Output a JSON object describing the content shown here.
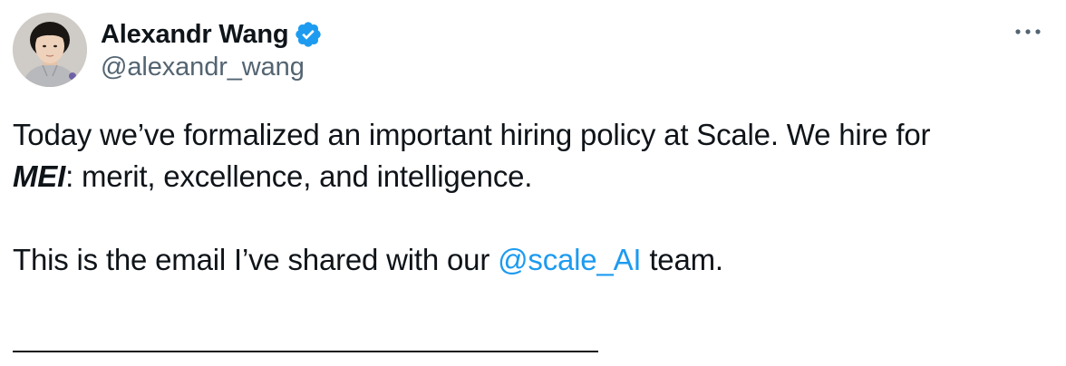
{
  "author": {
    "display_name": "Alexandr Wang",
    "handle": "@alexandr_wang",
    "verified": true,
    "verified_icon": "verified-badge-icon",
    "avatar_icon": "avatar-photo"
  },
  "menu": {
    "icon": "more-horizontal-icon"
  },
  "tweet": {
    "line1": "Today we’ve formalized an important hiring policy at Scale. We hire for",
    "line2_bold": "MEI",
    "line2_rest": ": merit, excellence, and intelligence.",
    "line3_pre": "This is the email I’ve shared with our ",
    "mention": "@scale_AI",
    "line3_post": " team."
  },
  "colors": {
    "text": "#0f1419",
    "secondary": "#536471",
    "link": "#1d9bf0",
    "verified": "#1d9bf0"
  }
}
